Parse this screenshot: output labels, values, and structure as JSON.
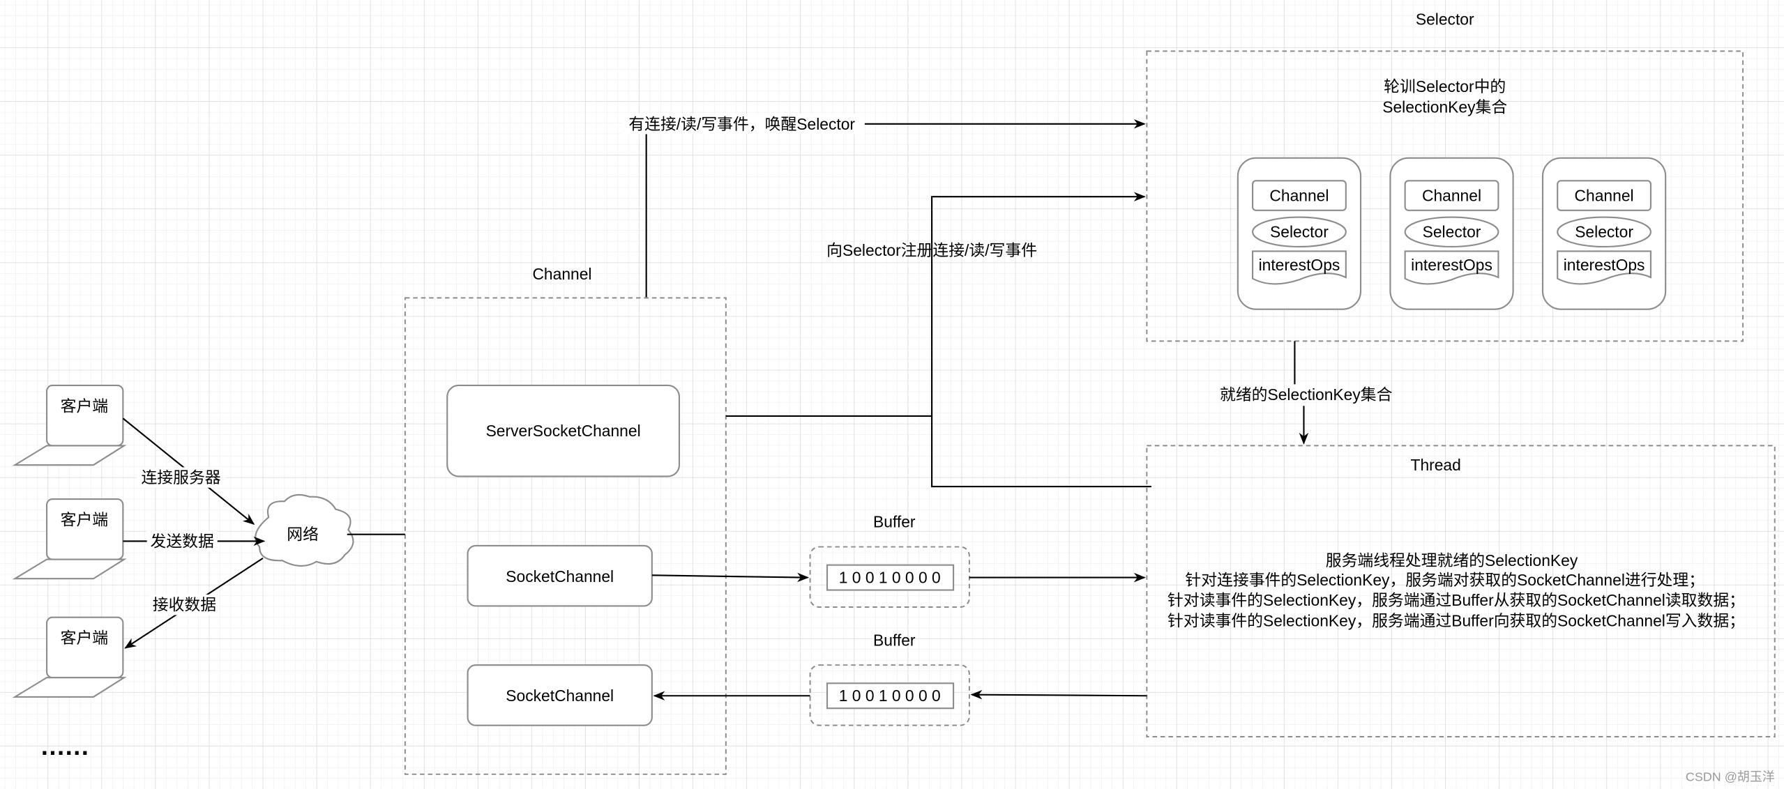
{
  "selector": {
    "title": "Selector",
    "desc_line1": "轮训Selector中的",
    "desc_line2": "SelectionKey集合",
    "keys": [
      {
        "channel": "Channel",
        "selector": "Selector",
        "ops": "interestOps"
      },
      {
        "channel": "Channel",
        "selector": "Selector",
        "ops": "interestOps"
      },
      {
        "channel": "Channel",
        "selector": "Selector",
        "ops": "interestOps"
      }
    ]
  },
  "channel": {
    "title": "Channel",
    "server": "ServerSocketChannel",
    "socket1": "SocketChannel",
    "socket2": "SocketChannel"
  },
  "buffers": [
    {
      "title": "Buffer",
      "value": "1 0 0 1 0 0 0 0"
    },
    {
      "title": "Buffer",
      "value": "1 0 0 1 0 0 0 0"
    }
  ],
  "edges": {
    "wake": "有连接/读/写事件，唤醒Selector",
    "register": "向Selector注册连接/读/写事件",
    "ready": "就绪的SelectionKey集合",
    "connect": "连接服务器",
    "send": "发送数据",
    "receive": "接收数据"
  },
  "thread": {
    "title": "Thread",
    "lines": [
      "服务端线程处理就绪的SelectionKey",
      "针对连接事件的SelectionKey，服务端对获取的SocketChannel进行处理；",
      "针对读事件的SelectionKey，服务端通过Buffer从获取的SocketChannel读取数据；",
      "针对读事件的SelectionKey，服务端通过Buffer向获取的SocketChannel写入数据；"
    ]
  },
  "clients": [
    "客户端",
    "客户端",
    "客户端"
  ],
  "network": "网络",
  "ellipsis": "......",
  "watermark": "CSDN @胡玉洋",
  "colors": {
    "grid_major": "#d4d4d4",
    "grid_minor": "#eeeeee",
    "shape_stroke": "#8c8c8c"
  }
}
